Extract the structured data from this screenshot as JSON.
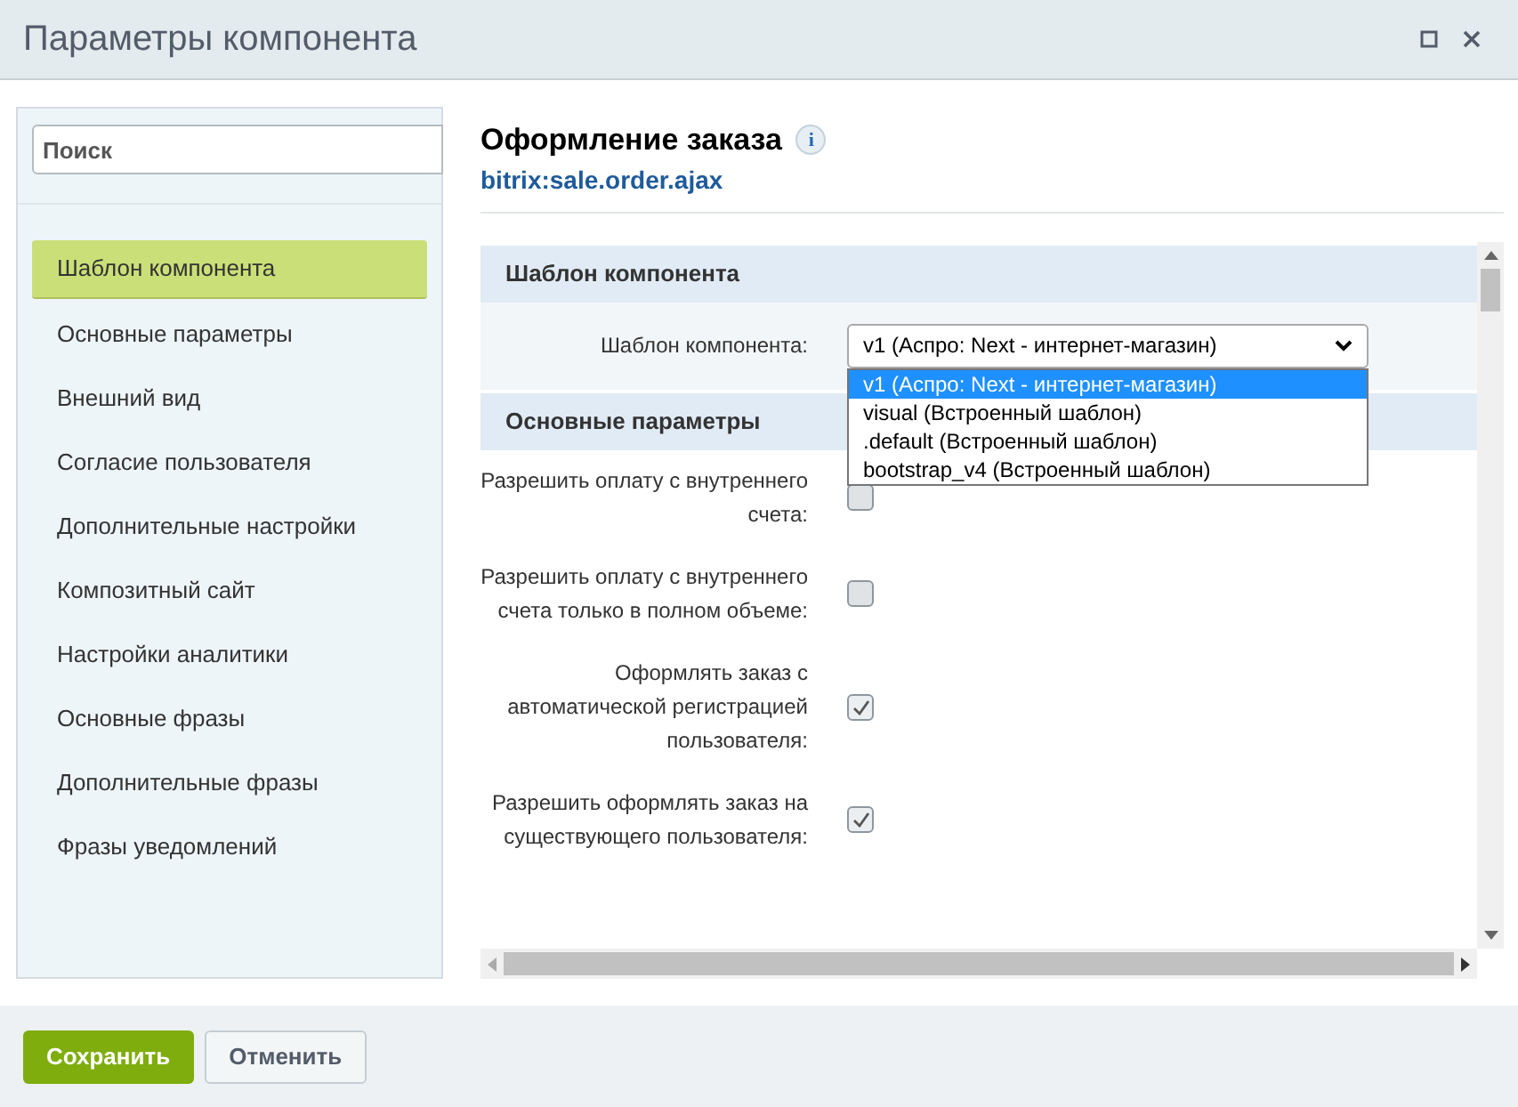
{
  "window": {
    "title": "Параметры компонента"
  },
  "sidebar": {
    "search": {
      "placeholder": "Поиск"
    },
    "items": [
      {
        "label": "Шаблон компонента",
        "selected": true
      },
      {
        "label": "Основные параметры",
        "selected": false
      },
      {
        "label": "Внешний вид",
        "selected": false
      },
      {
        "label": "Согласие пользователя",
        "selected": false
      },
      {
        "label": "Дополнительные настройки",
        "selected": false
      },
      {
        "label": "Композитный сайт",
        "selected": false
      },
      {
        "label": "Настройки аналитики",
        "selected": false
      },
      {
        "label": "Основные фразы",
        "selected": false
      },
      {
        "label": "Дополнительные фразы",
        "selected": false
      },
      {
        "label": "Фразы уведомлений",
        "selected": false
      }
    ]
  },
  "component": {
    "title": "Оформление заказа",
    "info": "i",
    "code": "bitrix:sale.order.ajax"
  },
  "sections": [
    {
      "title": "Шаблон компонента",
      "fields": [
        {
          "kind": "select",
          "label": "Шаблон компонента:",
          "value": "v1 (Аспро: Next - интернет-магазин)",
          "expanded": true,
          "options": [
            {
              "label": "v1 (Аспро: Next - интернет-магазин)",
              "selected": true
            },
            {
              "label": "visual (Встроенный шаблон)",
              "selected": false
            },
            {
              "label": ".default (Встроенный шаблон)",
              "selected": false
            },
            {
              "label": "bootstrap_v4 (Встроенный шаблон)",
              "selected": false
            }
          ]
        }
      ]
    },
    {
      "title": "Основные параметры",
      "fields": [
        {
          "kind": "checkbox",
          "label": "Разрешить оплату с внутреннего счета:",
          "checked": false
        },
        {
          "kind": "checkbox",
          "label": "Разрешить оплату с внутреннего счета только в полном объеме:",
          "checked": false
        },
        {
          "kind": "checkbox",
          "label": "Оформлять заказ с автоматической регистрацией пользователя:",
          "checked": true
        },
        {
          "kind": "checkbox",
          "label": "Разрешить оформлять заказ на существующего пользователя:",
          "checked": true
        }
      ]
    }
  ],
  "buttons": [
    {
      "kind": "primary",
      "label": "Сохранить"
    },
    {
      "kind": "secondary",
      "label": "Отменить"
    }
  ]
}
